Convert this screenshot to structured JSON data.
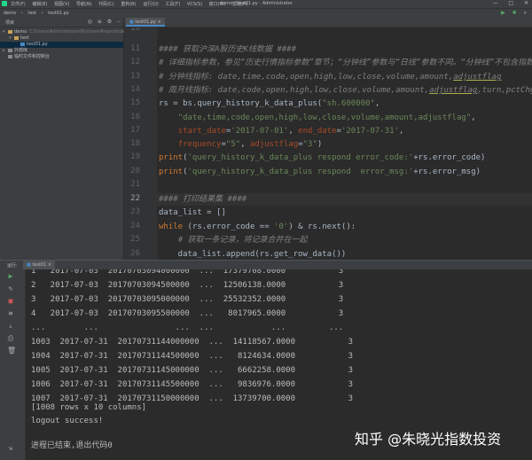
{
  "menubar": {
    "items": [
      "文件(F)",
      "编辑(E)",
      "视图(V)",
      "导航(N)",
      "代码(C)",
      "重构(R)",
      "运行(U)",
      "工具(T)",
      "VCS(S)",
      "窗口(W)",
      "帮助(H)"
    ],
    "title": "demo - test01.py - Administrator",
    "minimize": "—",
    "maximize": "□",
    "close": "✕"
  },
  "navbar": {
    "crumbs": [
      "demo",
      "test",
      "test01.py"
    ]
  },
  "project": {
    "label": "项目",
    "tree": [
      {
        "arrow": "▾",
        "name": "demo",
        "sub": "C:\\Users\\Administrator\\PycharmProjects\\demo",
        "icon": "folder-icon"
      },
      {
        "arrow": "▾",
        "name": "test",
        "sub": "",
        "icon": "folder-icon"
      },
      {
        "arrow": "",
        "name": "test01.py",
        "sub": "",
        "icon": "python-file-icon"
      },
      {
        "arrow": "▸",
        "name": "外部库",
        "sub": "",
        "icon": "library-icon"
      },
      {
        "arrow": "",
        "name": "临时文件和控制台",
        "sub": "",
        "icon": "scratch-icon"
      }
    ]
  },
  "editor": {
    "tab": "test01.py",
    "line_numbers": [
      "10",
      "11",
      "12",
      "13",
      "14",
      "15",
      "16",
      "17",
      "18",
      "19",
      "20",
      "21",
      "22",
      "23",
      "24",
      "25",
      "26"
    ],
    "current_line": "22"
  },
  "run": {
    "label": "运行:",
    "tab": "test01",
    "console": [
      "1   2017-07-03  20170703094000000  ...  17379708.0000           3",
      "2   2017-07-03  20170703094500000  ...  12506138.0000           3",
      "3   2017-07-03  20170703095000000  ...  25532352.0000           3",
      "4   2017-07-03  20170703095500000  ...   8017965.0000           3",
      "...        ...                ...  ...            ...         ...",
      "1003  2017-07-31  20170731144000000  ...  14118567.0000           3",
      "1004  2017-07-31  20170731144500000  ...   8124634.0000           3",
      "1005  2017-07-31  20170731145000000  ...   6662258.0000           3",
      "1006  2017-07-31  20170731145500000  ...   9836976.0000           3",
      "1007  2017-07-31  20170731150000000  ...  13739700.0000           3",
      "",
      "[1008 rows x 10 columns]",
      "logout success!",
      "",
      "进程已结束,退出代码0"
    ]
  },
  "watermark": "知乎 @朱晓光指数投资"
}
